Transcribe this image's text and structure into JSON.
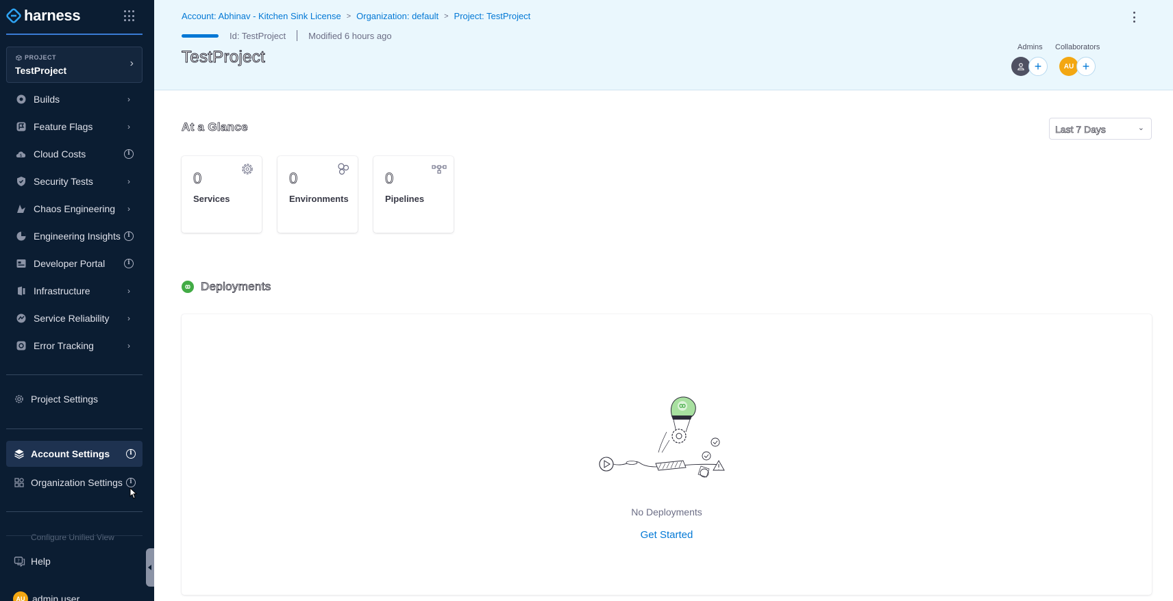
{
  "brand": {
    "name": "harness"
  },
  "project_card": {
    "kicker": "PROJECT",
    "name": "TestProject"
  },
  "sidebar": {
    "modules": [
      {
        "label": "Builds",
        "trail": "chevron"
      },
      {
        "label": "Feature Flags",
        "trail": "chevron"
      },
      {
        "label": "Cloud Costs",
        "trail": "info"
      },
      {
        "label": "Security Tests",
        "trail": "chevron"
      },
      {
        "label": "Chaos Engineering",
        "trail": "chevron"
      },
      {
        "label": "Engineering Insights",
        "trail": "info"
      },
      {
        "label": "Developer Portal",
        "trail": "info"
      },
      {
        "label": "Infrastructure",
        "trail": "chevron"
      },
      {
        "label": "Service Reliability",
        "trail": "chevron"
      },
      {
        "label": "Error Tracking",
        "trail": "chevron"
      }
    ],
    "project_settings": "Project Settings",
    "account_settings": "Account Settings",
    "organization_settings": "Organization Settings",
    "configure_view": "Configure Unified View",
    "help": "Help",
    "user": {
      "initials": "AU",
      "name": "admin user"
    }
  },
  "header": {
    "breadcrumb": [
      "Account: Abhinav - Kitchen Sink License",
      "Organization: default",
      "Project: TestProject"
    ],
    "id_text": "Id: TestProject",
    "modified_text": "Modified 6 hours ago",
    "title": "TestProject",
    "admins_label": "Admins",
    "collaborators_label": "Collaborators",
    "collaborator_initials": "AU",
    "add_symbol": "+"
  },
  "glance": {
    "title": "At a Glance",
    "range": "Last 7 Days",
    "stats": [
      {
        "value": "0",
        "label": "Services",
        "icon": "gear-icon"
      },
      {
        "value": "0",
        "label": "Environments",
        "icon": "environments-icon"
      },
      {
        "value": "0",
        "label": "Pipelines",
        "icon": "pipeline-icon"
      }
    ]
  },
  "deployments": {
    "title": "Deployments",
    "empty_text": "No Deployments",
    "cta": "Get Started"
  },
  "colors": {
    "sidebar_bg": "#0b1d32",
    "header_bg": "#eaf7fd",
    "accent": "#0278d5",
    "avatar_orange": "#f3a712",
    "cd_green": "#42ab45"
  }
}
